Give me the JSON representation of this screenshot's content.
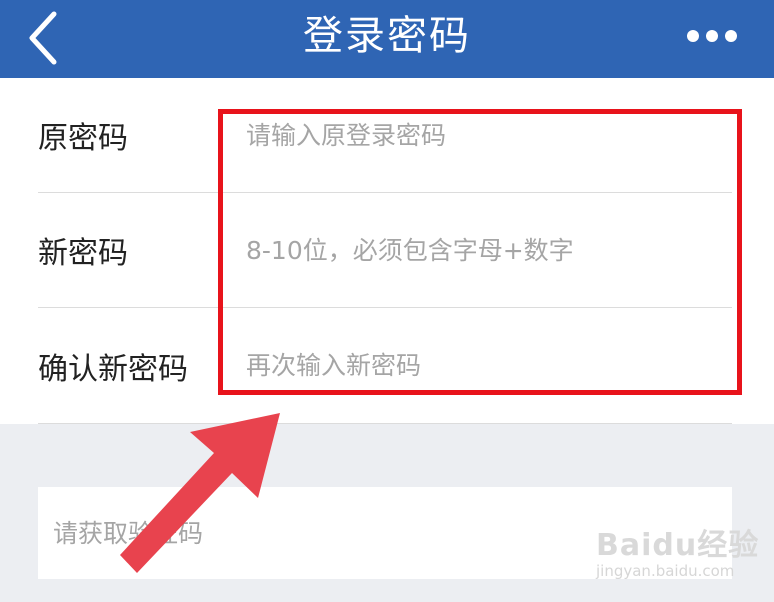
{
  "header": {
    "title": "登录密码",
    "back_icon": "chevron-left-icon",
    "more_icon": "more-dots-icon"
  },
  "form": {
    "rows": [
      {
        "label": "原密码",
        "placeholder": "请输入原登录密码",
        "value": ""
      },
      {
        "label": "新密码",
        "placeholder": "8-10位，必须包含字母+数字",
        "value": ""
      },
      {
        "label": "确认新密码",
        "placeholder": "再次输入新密码",
        "value": ""
      }
    ]
  },
  "verification": {
    "placeholder": "请获取验证码",
    "value": ""
  },
  "annotation": {
    "box_color": "#e8131b",
    "arrow_color": "#e8434e"
  },
  "watermark": {
    "brand": "Baidu经验",
    "url": "jingyan.baidu.com"
  },
  "colors": {
    "header_bg": "#2f65b4",
    "page_bg": "#eceef2",
    "card_bg": "#ffffff"
  }
}
